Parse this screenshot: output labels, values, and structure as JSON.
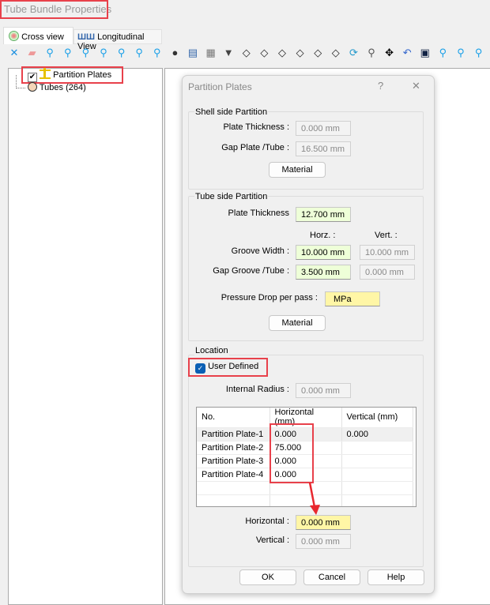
{
  "window_title": "Tube Bundle Properties",
  "tabs": [
    {
      "label": "Cross view"
    },
    {
      "label": "Longitudinal View"
    }
  ],
  "toolbar_icons": [
    "select-icon",
    "eraser-icon",
    "add-node-icon",
    "add-node-multi-icon",
    "add-node-double-icon",
    "add-node-red-icon",
    "add-rect-icon",
    "add-shield-icon",
    "add-pin-icon",
    "disk-icon",
    "document-icon",
    "print-icon",
    "funnel-icon",
    "cut-line-icon",
    "cut-diag-icon",
    "view-box-icon",
    "circle-slash-icon",
    "target-icon",
    "split-icon",
    "refresh-icon",
    "zoom-icon",
    "move-icon",
    "undo-icon",
    "window-icon",
    "node-link-icon",
    "node-link2-icon",
    "node-cut-icon"
  ],
  "tree": {
    "items": [
      {
        "label": "Partition Plates",
        "checked": true
      },
      {
        "label": "Tubes (264)"
      }
    ]
  },
  "dialog": {
    "title": "Partition Plates",
    "help": "?",
    "close": "✕",
    "shell": {
      "title": "Shell side Partition",
      "plate_thickness_label": "Plate Thickness :",
      "plate_thickness": "0.000 mm",
      "gap_label": "Gap Plate /Tube :",
      "gap": "16.500 mm",
      "material": "Material"
    },
    "tube": {
      "title": "Tube side Partition",
      "plate_thickness_label": "Plate Thickness",
      "plate_thickness": "12.700 mm",
      "horz": "Horz. :",
      "vert": "Vert. :",
      "groove_width_label": "Groove Width :",
      "groove_width_h": "10.000 mm",
      "groove_width_v": "10.000 mm",
      "gap_groove_label": "Gap Groove /Tube :",
      "gap_groove_h": "3.500 mm",
      "gap_groove_v": "0.000 mm",
      "pressure_label": "Pressure Drop per pass :",
      "pressure": "MPa",
      "material": "Material"
    },
    "location": {
      "title": "Location",
      "user_defined": "User Defined",
      "user_defined_checked": true,
      "internal_radius_label": "Internal Radius :",
      "internal_radius": "0.000 mm",
      "table": {
        "headers": [
          "No.",
          "Horizontal (mm)",
          "Vertical (mm)"
        ],
        "rows": [
          [
            "Partition Plate-1",
            "0.000",
            "0.000"
          ],
          [
            "Partition Plate-2",
            "75.000",
            ""
          ],
          [
            "Partition Plate-3",
            "0.000",
            ""
          ],
          [
            "Partition Plate-4",
            "0.000",
            ""
          ],
          [
            "",
            "",
            ""
          ],
          [
            "",
            "",
            ""
          ]
        ]
      },
      "horizontal_label": "Horizontal :",
      "horizontal": "0.000 mm",
      "vertical_label": "Vertical :",
      "vertical": "0.000 mm"
    },
    "buttons": {
      "ok": "OK",
      "cancel": "Cancel",
      "help": "Help"
    }
  }
}
